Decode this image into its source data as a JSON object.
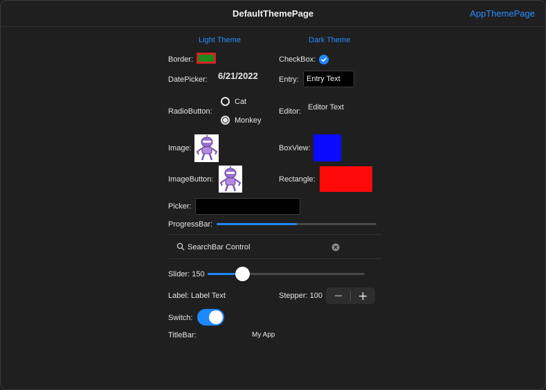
{
  "window": {
    "title": "DefaultThemePage",
    "nav_link": "AppThemePage"
  },
  "theme_buttons": {
    "light": "Light Theme",
    "dark": "Dark Theme"
  },
  "labels": {
    "border": "Border:",
    "checkbox": "CheckBox:",
    "datepicker": "DatePicker:",
    "entry": "Entry:",
    "radiobutton": "RadioButton:",
    "editor": "Editor:",
    "image": "Image:",
    "boxview": "BoxView:",
    "imagebutton": "ImageButton:",
    "rectangle": "Rectangle:",
    "picker": "Picker:",
    "progressbar": "ProgressBar:",
    "slider": "Slider: 150",
    "label": "Label: Label Text",
    "stepper": "Stepper: 100",
    "switch": "Switch:",
    "titlebar": "TitleBar:"
  },
  "values": {
    "date": "6/21/2022",
    "entry_text": "Entry Text",
    "editor_text": "Editor Text",
    "radio_options": [
      "Cat",
      "Monkey"
    ],
    "radio_selected": "Monkey",
    "progress": 0.5,
    "search_text": "SearchBar Control",
    "slider_value": 0.22,
    "checkbox_checked": true,
    "switch_on": true,
    "titlebar_text": "My App"
  },
  "colors": {
    "accent": "#1e88ff",
    "border_fill": "#1b8a1b",
    "border_stroke": "#d42323",
    "boxview": "#0a0aff",
    "rectangle": "#ff0a0a"
  },
  "icons": {
    "checkbox": "checkmark-icon",
    "search": "search-icon",
    "clear": "clear-icon",
    "stepper_minus": "minus-icon",
    "stepper_plus": "plus-icon",
    "image": "bot-mascot-icon"
  }
}
